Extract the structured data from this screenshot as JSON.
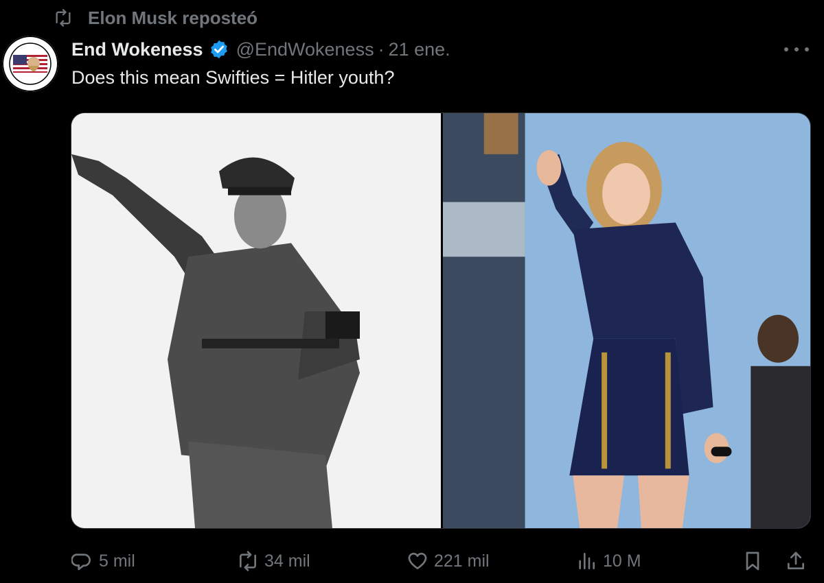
{
  "repost": {
    "label": "Elon Musk reposteó",
    "icon": "repost-icon"
  },
  "author": {
    "name": "End Wokeness",
    "handle": "@EndWokeness",
    "separator": "·",
    "date": "21 ene.",
    "verified": true,
    "verified_color": "#1d9bf0"
  },
  "tweet": {
    "text": "Does this mean Swifties = Hitler youth?"
  },
  "media": {
    "left_image": "black-and-white-photo-uniformed-man-raised-arm",
    "right_image": "color-photo-performer-on-stage-raised-hand"
  },
  "actions": {
    "replies": "5 mil",
    "reposts": "34 mil",
    "likes": "221 mil",
    "views": "10 M"
  },
  "colors": {
    "background": "#000000",
    "text": "#e7e9ea",
    "muted": "#71767b",
    "accent": "#1d9bf0"
  }
}
